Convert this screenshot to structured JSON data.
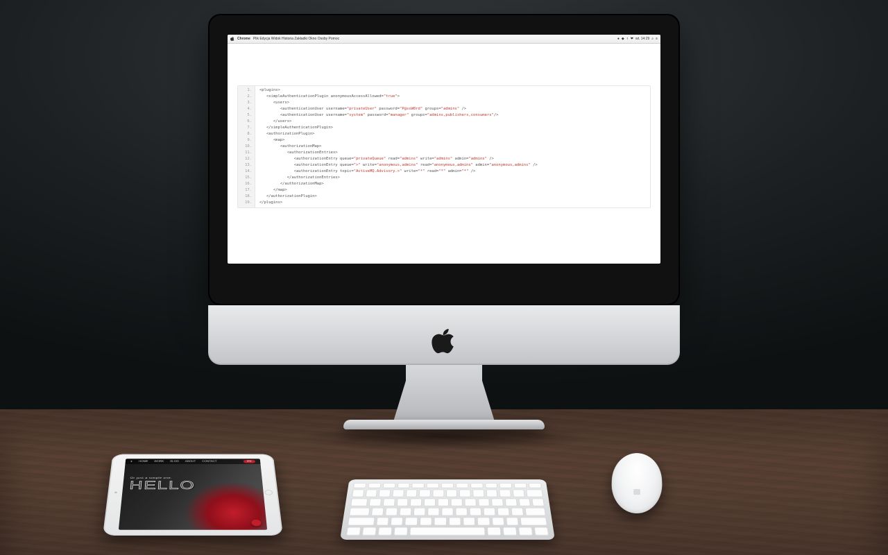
{
  "menubar": {
    "app": "Chrome",
    "items": [
      "Plik",
      "Edycja",
      "Widok",
      "Historia",
      "Zakładki",
      "Okno",
      "Osoby",
      "Pomoc"
    ],
    "clock": "wt. 14:29"
  },
  "code": {
    "lines": [
      {
        "n": "1.",
        "indent": 0,
        "tokens": [
          {
            "t": "tag",
            "v": "<plugins>"
          }
        ]
      },
      {
        "n": "2.",
        "indent": 1,
        "tokens": [
          {
            "t": "tag",
            "v": "<simpleAuthenticationPlugin "
          },
          {
            "t": "attr",
            "v": "anonymousAccessAllowed="
          },
          {
            "t": "str",
            "v": "\"true\""
          },
          {
            "t": "tag",
            "v": ">"
          }
        ]
      },
      {
        "n": "3.",
        "indent": 2,
        "tokens": [
          {
            "t": "tag",
            "v": "<users>"
          }
        ]
      },
      {
        "n": "4.",
        "indent": 3,
        "tokens": [
          {
            "t": "tag",
            "v": "<authenticationUser "
          },
          {
            "t": "attr",
            "v": "username="
          },
          {
            "t": "str",
            "v": "\"privateUser\""
          },
          {
            "t": "attr",
            "v": " password="
          },
          {
            "t": "str",
            "v": "\"P@ssW0rd\""
          },
          {
            "t": "attr",
            "v": " groups="
          },
          {
            "t": "str",
            "v": "\"admins\""
          },
          {
            "t": "tag",
            "v": " />"
          }
        ]
      },
      {
        "n": "5.",
        "indent": 3,
        "tokens": [
          {
            "t": "tag",
            "v": "<authenticationUser "
          },
          {
            "t": "attr",
            "v": "username="
          },
          {
            "t": "str",
            "v": "\"system\""
          },
          {
            "t": "attr",
            "v": " password="
          },
          {
            "t": "str",
            "v": "\"manager\""
          },
          {
            "t": "attr",
            "v": " groups="
          },
          {
            "t": "str",
            "v": "\"admins,publishers,consumers\""
          },
          {
            "t": "tag",
            "v": "/>"
          }
        ]
      },
      {
        "n": "6.",
        "indent": 2,
        "tokens": [
          {
            "t": "tag",
            "v": "</users>"
          }
        ]
      },
      {
        "n": "7.",
        "indent": 1,
        "tokens": [
          {
            "t": "tag",
            "v": "</simpleAuthenticationPlugin>"
          }
        ]
      },
      {
        "n": "8.",
        "indent": 1,
        "tokens": [
          {
            "t": "tag",
            "v": "<authorizationPlugin>"
          }
        ]
      },
      {
        "n": "9.",
        "indent": 2,
        "tokens": [
          {
            "t": "tag",
            "v": "<map>"
          }
        ]
      },
      {
        "n": "10.",
        "indent": 3,
        "tokens": [
          {
            "t": "tag",
            "v": "<authorizationMap>"
          }
        ]
      },
      {
        "n": "11.",
        "indent": 4,
        "tokens": [
          {
            "t": "tag",
            "v": "<authorizationEntries>"
          }
        ]
      },
      {
        "n": "12.",
        "indent": 5,
        "tokens": [
          {
            "t": "tag",
            "v": "<authorizationEntry "
          },
          {
            "t": "attr",
            "v": "queue="
          },
          {
            "t": "str",
            "v": "\"privateQueue\""
          },
          {
            "t": "attr",
            "v": " read="
          },
          {
            "t": "str",
            "v": "\"admins\""
          },
          {
            "t": "attr",
            "v": " write="
          },
          {
            "t": "str",
            "v": "\"admins\""
          },
          {
            "t": "attr",
            "v": " admin="
          },
          {
            "t": "str",
            "v": "\"admins\""
          },
          {
            "t": "tag",
            "v": " />"
          }
        ]
      },
      {
        "n": "13.",
        "indent": 5,
        "tokens": [
          {
            "t": "tag",
            "v": "<authorizationEntry "
          },
          {
            "t": "attr",
            "v": "queue="
          },
          {
            "t": "str",
            "v": "\">\""
          },
          {
            "t": "attr",
            "v": " write="
          },
          {
            "t": "str",
            "v": "\"anonymous,admins\""
          },
          {
            "t": "attr",
            "v": " read="
          },
          {
            "t": "str",
            "v": "\"anonymous,admins\""
          },
          {
            "t": "attr",
            "v": " admin="
          },
          {
            "t": "str",
            "v": "\"anonymous,admins\""
          },
          {
            "t": "tag",
            "v": " />"
          }
        ]
      },
      {
        "n": "14.",
        "indent": 5,
        "tokens": [
          {
            "t": "tag",
            "v": "<authorizationEntry "
          },
          {
            "t": "attr",
            "v": "topic="
          },
          {
            "t": "str",
            "v": "\"ActiveMQ.Advisory.>\""
          },
          {
            "t": "attr",
            "v": " write="
          },
          {
            "t": "str",
            "v": "\"*\""
          },
          {
            "t": "attr",
            "v": " read="
          },
          {
            "t": "str",
            "v": "\"*\""
          },
          {
            "t": "attr",
            "v": " admin="
          },
          {
            "t": "str",
            "v": "\"*\""
          },
          {
            "t": "tag",
            "v": " />"
          }
        ]
      },
      {
        "n": "15.",
        "indent": 4,
        "tokens": [
          {
            "t": "tag",
            "v": "</authorizationEntries>"
          }
        ]
      },
      {
        "n": "16.",
        "indent": 3,
        "tokens": [
          {
            "t": "tag",
            "v": "</authorizationMap>"
          }
        ]
      },
      {
        "n": "17.",
        "indent": 2,
        "tokens": [
          {
            "t": "tag",
            "v": "</map>"
          }
        ]
      },
      {
        "n": "18.",
        "indent": 1,
        "tokens": [
          {
            "t": "tag",
            "v": "</authorizationPlugin>"
          }
        ]
      },
      {
        "n": "19.",
        "indent": 0,
        "tokens": [
          {
            "t": "tag",
            "v": "</plugins>"
          }
        ]
      }
    ]
  },
  "ipad": {
    "nav": [
      "HOME",
      "WORK",
      "BLOG",
      "ABOUT",
      "CONTACT"
    ],
    "pill": "EN",
    "hero_small": "Or just a simple one.",
    "hero_big": "HELLO"
  }
}
